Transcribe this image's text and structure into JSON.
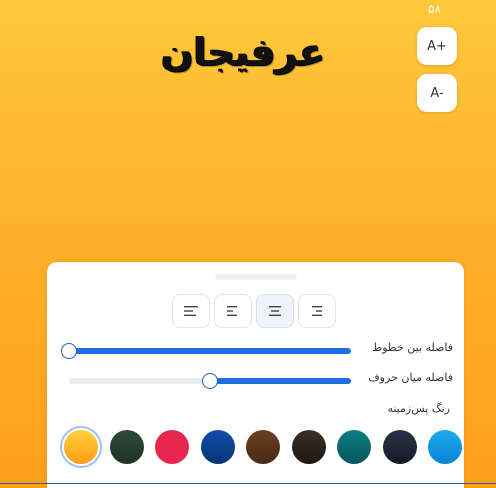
{
  "status": {
    "counter": "۵۸"
  },
  "header": {
    "title": "عرفیجان"
  },
  "font_size": {
    "increase_label": "A+",
    "decrease_label": "A-"
  },
  "alignment": {
    "options": [
      "left",
      "center",
      "justify",
      "right"
    ],
    "selected": "justify"
  },
  "settings": {
    "line_spacing": {
      "label": "فاصله بین خطوط",
      "value": 1.0
    },
    "letter_spacing": {
      "label": "فاصله میان حروف",
      "value": 0.5
    },
    "background_color_label": "رنگ پس‌زمینه"
  },
  "swatches": [
    {
      "name": "sunset-yellow",
      "color": "linear-gradient(180deg,#FFD23C,#FF9A1A)",
      "selected": true
    },
    {
      "name": "dark-green",
      "color": "linear-gradient(180deg,#2E4A36,#1F3326)"
    },
    {
      "name": "crimson",
      "color": "#E8274F"
    },
    {
      "name": "navy-blue",
      "color": "linear-gradient(180deg,#0E4BA8,#0A3576)"
    },
    {
      "name": "brown",
      "color": "linear-gradient(180deg,#6A3E22,#4A2A16)"
    },
    {
      "name": "dark-brown",
      "color": "linear-gradient(180deg,#3C2F25,#1F1812)"
    },
    {
      "name": "teal",
      "color": "linear-gradient(180deg,#0B7F84,#07555A)"
    },
    {
      "name": "midnight",
      "color": "linear-gradient(180deg,#2A3446,#141A26)"
    },
    {
      "name": "sky-blue",
      "color": "linear-gradient(180deg,#1FA9EC,#0A84D2)"
    }
  ]
}
